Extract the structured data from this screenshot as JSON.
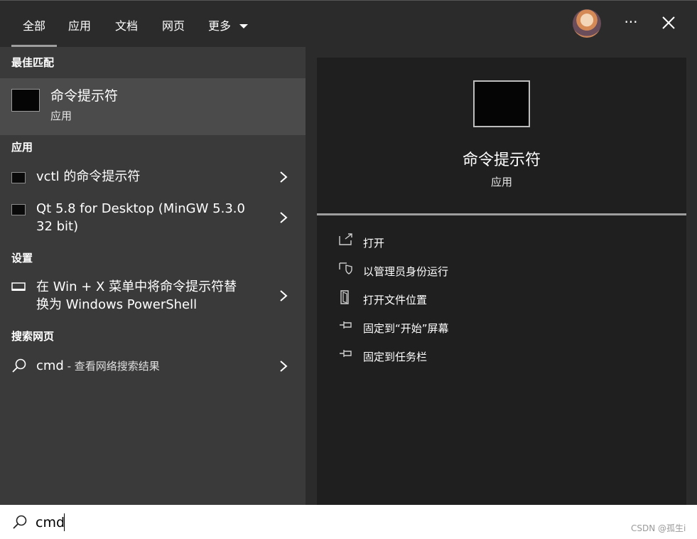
{
  "tabs": [
    "全部",
    "应用",
    "文档",
    "网页",
    "更多"
  ],
  "window": {
    "more_label": "···"
  },
  "left": {
    "best_match_header": "最佳匹配",
    "best_match": {
      "title": "命令提示符",
      "subtitle": "应用"
    },
    "apps_header": "应用",
    "apps": [
      {
        "line1": "vctl 的命令提示符",
        "line2": ""
      },
      {
        "line1": "Qt 5.8 for Desktop (MinGW 5.3.0",
        "line2": "32 bit)"
      }
    ],
    "settings_header": "设置",
    "settings": [
      {
        "line1": "在 Win + X 菜单中将命令提示符替",
        "line2": "换为 Windows PowerShell"
      }
    ],
    "web_header": "搜索网页",
    "web": {
      "query": "cmd",
      "suffix": " - 查看网络搜索结果"
    }
  },
  "right": {
    "title": "命令提示符",
    "subtitle": "应用",
    "actions": [
      {
        "label": "打开",
        "icon": "open-icon"
      },
      {
        "label": "以管理员身份运行",
        "icon": "shield-icon"
      },
      {
        "label": "打开文件位置",
        "icon": "file-location-icon"
      },
      {
        "label": "固定到“开始”屏幕",
        "icon": "pin-icon"
      },
      {
        "label": "固定到任务栏",
        "icon": "pin-icon"
      }
    ]
  },
  "search": {
    "value": "cmd"
  },
  "watermark": "CSDN @孤生i",
  "colors": {
    "top_bg": "#2b2b2b",
    "left_bg": "#3a3a3a",
    "right_bg": "#1f1f1f",
    "selected_row": "#4b4b4b"
  }
}
